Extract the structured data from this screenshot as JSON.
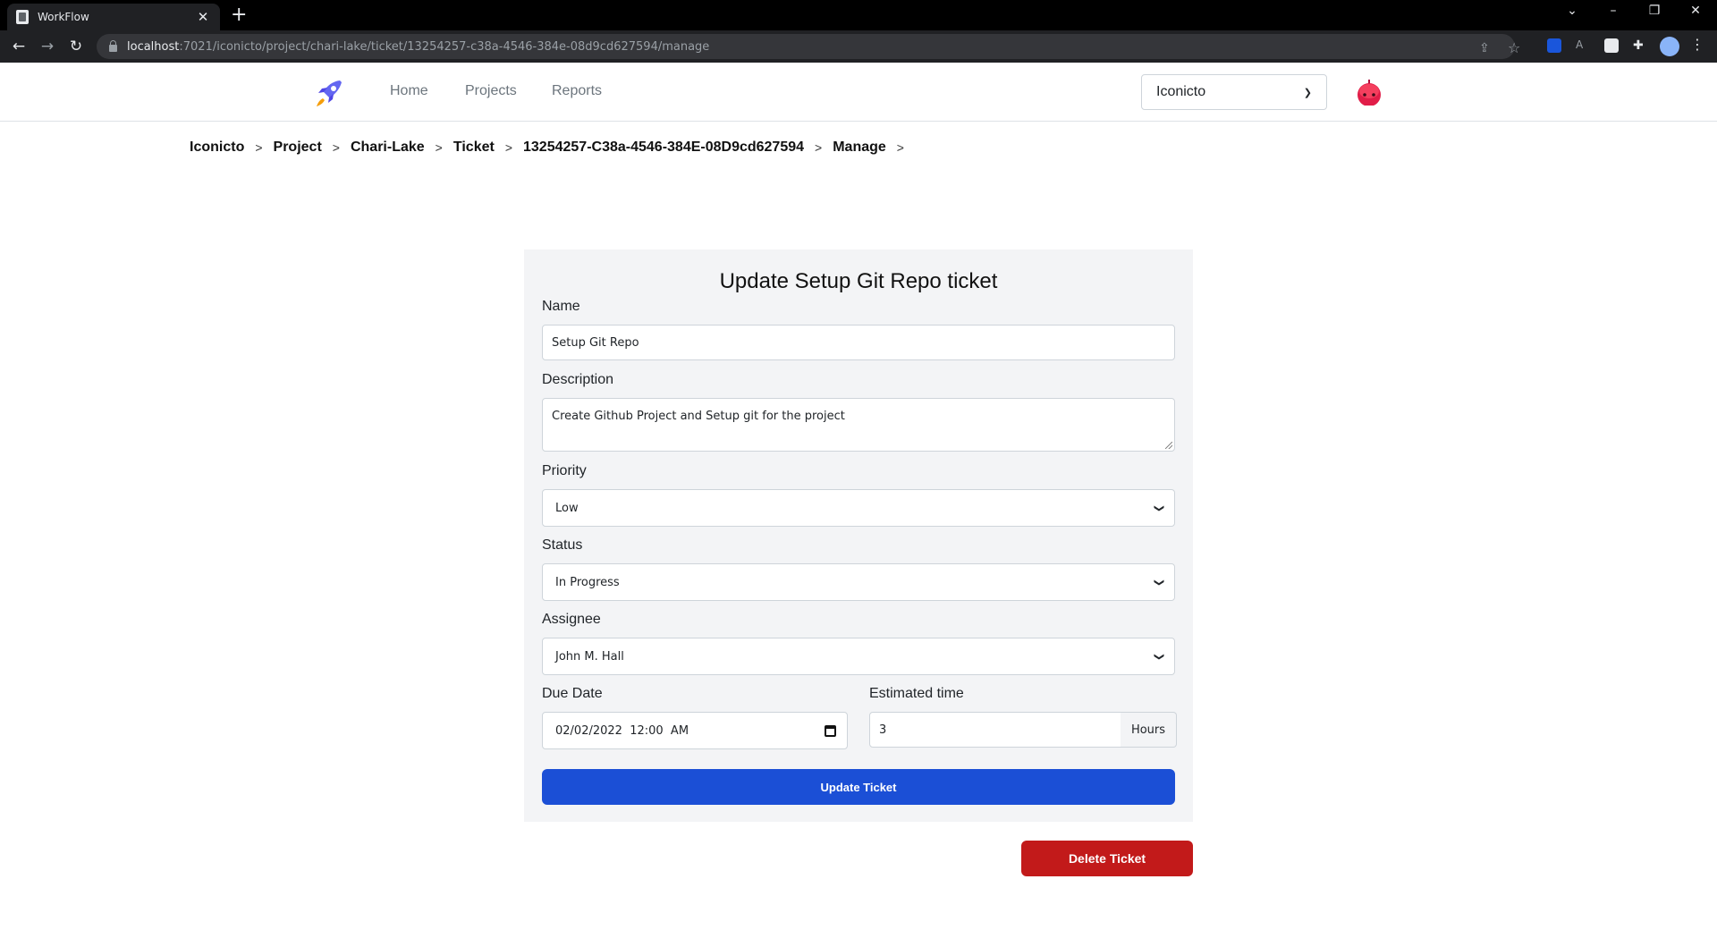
{
  "browser": {
    "tab_title": "WorkFlow",
    "tab_close": "✕",
    "new_tab": "+",
    "url_host": "localhost",
    "url_path": ":7021/iconicto/project/chari-lake/ticket/13254257-c38a-4546-384e-08d9cd627594/manage"
  },
  "navbar": {
    "links": [
      "Home",
      "Projects",
      "Reports"
    ],
    "org_selected": "Iconicto"
  },
  "breadcrumb": [
    "Iconicto",
    "Project",
    "Chari-Lake",
    "Ticket",
    "13254257-C38a-4546-384E-08D9cd627594",
    "Manage"
  ],
  "breadcrumb_separator": ">",
  "form": {
    "title": "Update Setup Git Repo ticket",
    "name_label": "Name",
    "name_value": "Setup Git Repo",
    "description_label": "Description",
    "description_value": "Create Github Project and Setup git for the project",
    "priority_label": "Priority",
    "priority_value": "Low",
    "status_label": "Status",
    "status_value": "In Progress",
    "assignee_label": "Assignee",
    "assignee_value": "John M. Hall",
    "due_date_label": "Due Date",
    "due_date_value": "02/02/2022  12:00  AM",
    "estimated_label": "Estimated time",
    "estimated_value": "3",
    "estimated_unit": "Hours",
    "update_button": "Update Ticket"
  },
  "delete_button": "Delete Ticket",
  "colors": {
    "primary": "#1b4fd6",
    "danger": "#c21a1a",
    "card_bg": "#f3f4f6"
  }
}
